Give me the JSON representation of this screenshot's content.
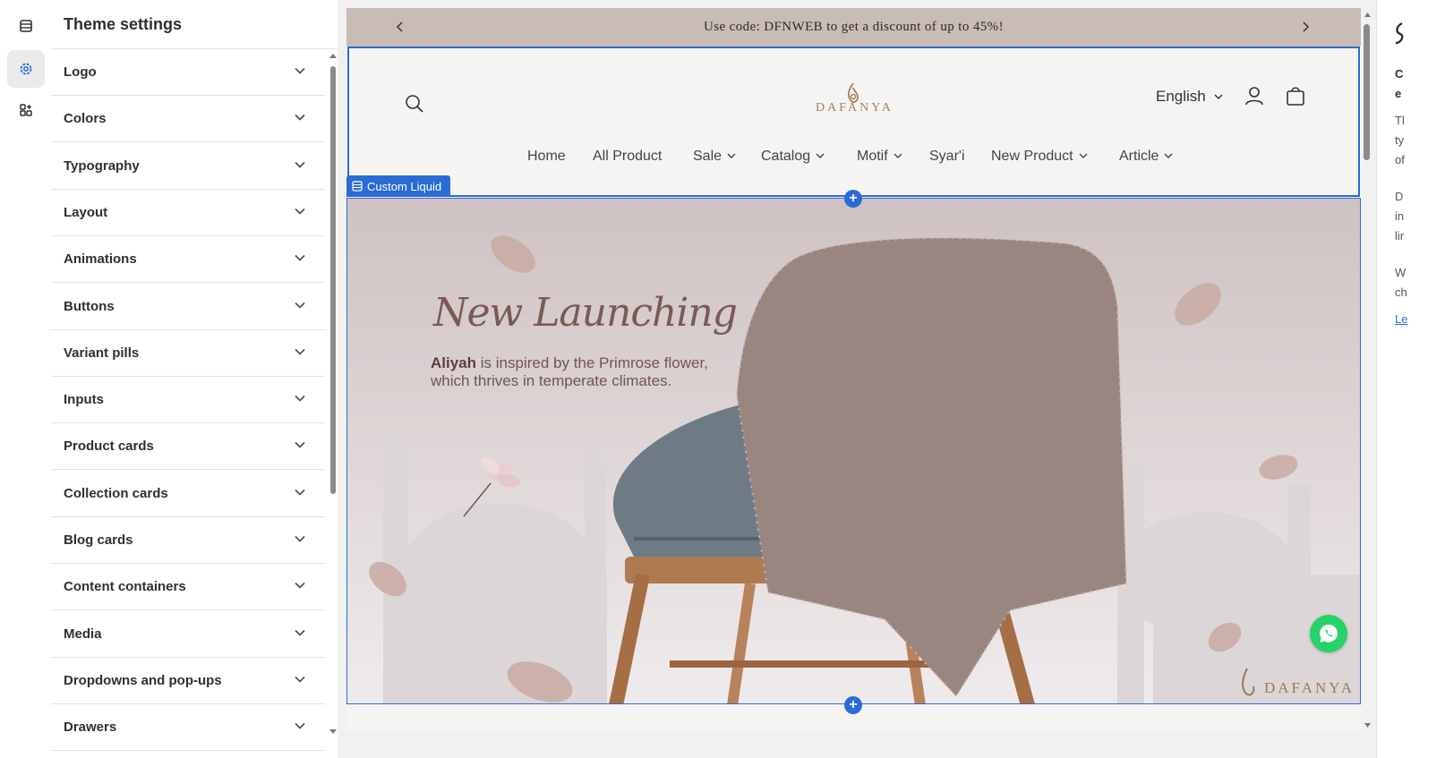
{
  "rail": {
    "items": [
      {
        "icon": "sections-icon",
        "active": false
      },
      {
        "icon": "gear-icon",
        "active": true
      },
      {
        "icon": "apps-icon",
        "active": false
      }
    ]
  },
  "panel": {
    "title": "Theme settings",
    "sections": [
      "Logo",
      "Colors",
      "Typography",
      "Layout",
      "Animations",
      "Buttons",
      "Variant pills",
      "Inputs",
      "Product cards",
      "Collection cards",
      "Blog cards",
      "Content containers",
      "Media",
      "Dropdowns and pop-ups",
      "Drawers"
    ]
  },
  "preview": {
    "announcement": "Use code: DFNWEB to get a discount of up to 45%!",
    "logo_text": "DAFANYA",
    "language": "English",
    "nav": [
      {
        "label": "Home",
        "dropdown": false
      },
      {
        "label": "All Product",
        "dropdown": false
      },
      {
        "label": "Sale",
        "dropdown": true
      },
      {
        "label": "Catalog",
        "dropdown": true
      },
      {
        "label": "Motif",
        "dropdown": true
      },
      {
        "label": "Syar'i",
        "dropdown": false
      },
      {
        "label": "New Product",
        "dropdown": true
      },
      {
        "label": "Article",
        "dropdown": true
      }
    ],
    "section_tag": "Custom Liquid",
    "hero": {
      "title": "New Launching",
      "subtitle_bold": "Aliyah",
      "subtitle_rest": " is inspired by the Primrose flower, which thrives in temperate climates.",
      "brand": "DAFANYA"
    }
  },
  "right_panel": {
    "lines": [
      "C",
      "e",
      "Tl",
      "ty",
      "of",
      "D",
      "in",
      "lir",
      "W",
      "ch",
      "Le"
    ]
  },
  "colors": {
    "accent": "#2b6cd4",
    "announcement_bg": "#c9bcb5",
    "logo": "#a97f5d",
    "whatsapp": "#25d366"
  }
}
